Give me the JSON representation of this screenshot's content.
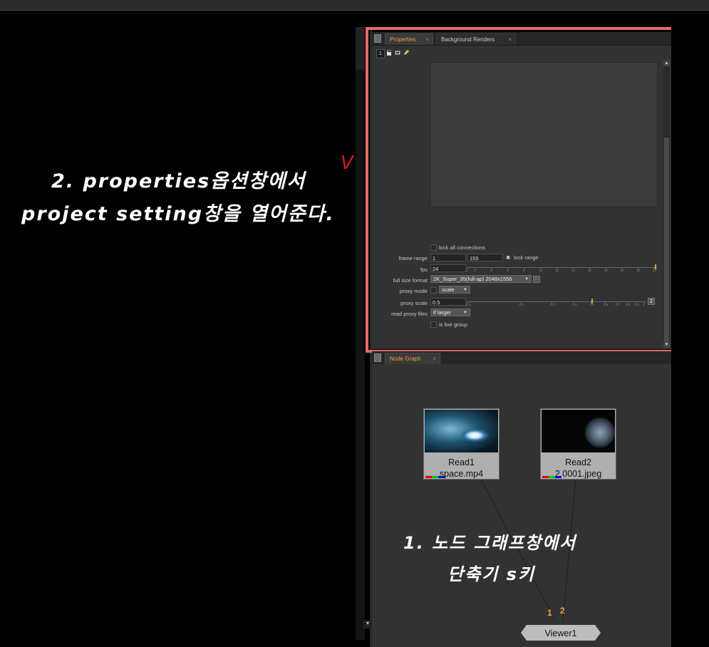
{
  "annotations": {
    "props_line1": "2. properties옵션창에서",
    "props_line2": "project setting창을 열어준다.",
    "check_mark": "V",
    "ng_line1": "1. 노드 그래프창에서",
    "ng_line2": "단축기 s키"
  },
  "properties_panel": {
    "tabs": [
      {
        "label": "Properties",
        "active": true
      },
      {
        "label": "Background Renders",
        "active": false
      }
    ],
    "close_glyph": "×",
    "toolbar_count": "1",
    "settings": {
      "lock_all_connections": "lock all connections",
      "frame_range_label": "frame range",
      "frame_range_start": "1",
      "frame_range_end": "155",
      "lock_range_label": "lock range",
      "fps_label": "fps",
      "fps_value": "24",
      "fps_ticks": [
        "1",
        "2",
        "4",
        "6",
        "8",
        "10",
        "12",
        "14",
        "16",
        "18",
        "20",
        "22",
        "24"
      ],
      "full_size_format_label": "full size format",
      "full_size_format_value": "2K_Super_35(full-ap) 2048x1556",
      "format_button": "...",
      "proxy_mode_label": "proxy mode",
      "proxy_mode_value": "scale",
      "proxy_scale_label": "proxy scale",
      "proxy_scale_value": "0.5",
      "proxy_scale_ticks": [
        "0.1",
        "0.2",
        "0.3",
        "0.4",
        "0.5",
        "0.6",
        "0.7",
        "0.8",
        "0.9",
        "1"
      ],
      "proxy_scale_button": "2",
      "read_proxy_files_label": "read proxy files",
      "read_proxy_files_value": "if larger",
      "is_live_group": "is live group"
    }
  },
  "node_graph": {
    "tab_label": "Node Graph",
    "nodes": [
      {
        "name": "Read1",
        "file": "space.mp4"
      },
      {
        "name": "Read2",
        "file": "2.0001.jpeg"
      }
    ],
    "viewer": {
      "name": "Viewer1",
      "input1": "1",
      "input2": "2"
    }
  },
  "colors": {
    "highlight_border": "#e66a6a",
    "active_tab_text": "#f0a040",
    "check_mark": "#d8192b"
  }
}
